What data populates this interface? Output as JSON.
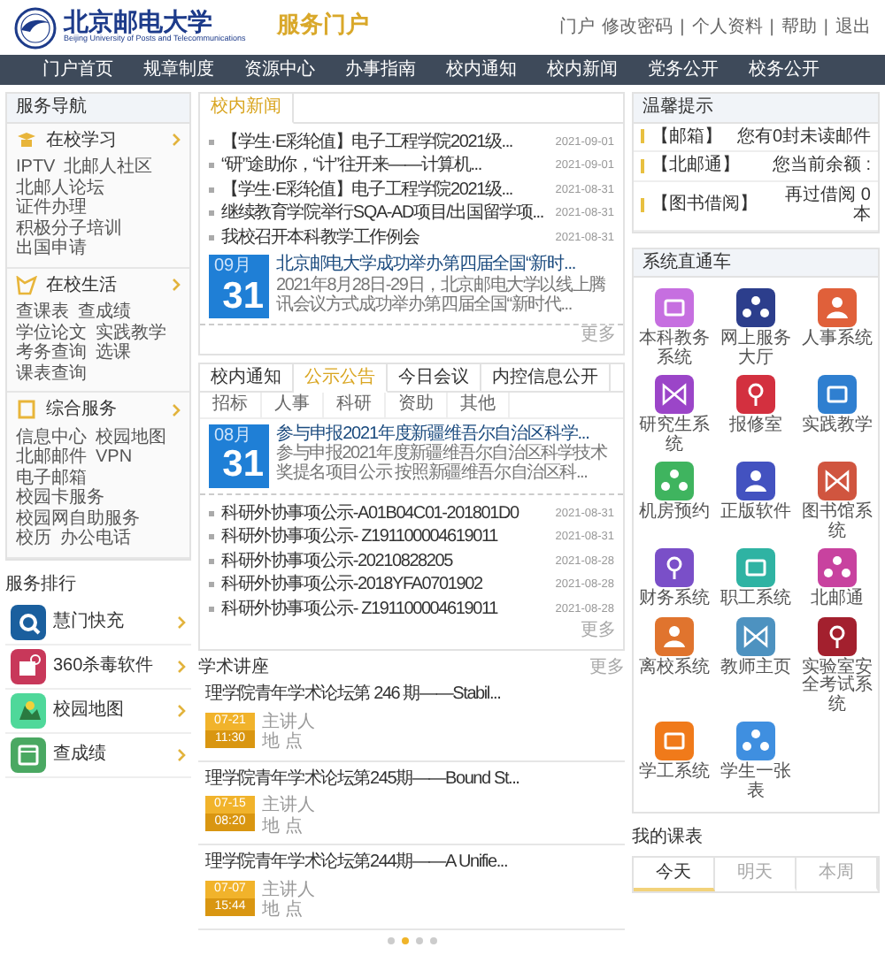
{
  "header": {
    "school_name": "北京邮电大学",
    "school_name_en": "Beijing University of Posts and Telecommunications",
    "portal_title": "服务门户",
    "user": "门户",
    "links": [
      "修改密码",
      "个人资料",
      "帮助",
      "退出"
    ],
    "separator": "|"
  },
  "nav": [
    "门户首页",
    "规章制度",
    "资源中心",
    "办事指南",
    "校内通知",
    "校内新闻",
    "党务公开",
    "校务公开"
  ],
  "service_nav": {
    "title": "服务导航",
    "sections": [
      {
        "title": "在校学习",
        "links": [
          "IPTV",
          "北邮人社区",
          "北邮人论坛",
          "证件办理",
          "积极分子培训",
          "出国申请"
        ]
      },
      {
        "title": "在校生活",
        "links": [
          "查课表",
          "查成绩",
          "学位论文",
          "实践教学",
          "考务查询",
          "选课",
          "课表查询"
        ]
      },
      {
        "title": "综合服务",
        "links": [
          "信息中心",
          "校园地图",
          "北邮邮件",
          "VPN",
          "电子邮箱",
          "校园卡服务",
          "校园网自助服务",
          "校历",
          "办公电话"
        ]
      }
    ]
  },
  "service_ranking": {
    "title": "服务排行",
    "items": [
      {
        "label": "慧门快充",
        "color": "#1a5f9e"
      },
      {
        "label": "360杀毒软件",
        "color": "#c8385a"
      },
      {
        "label": "校园地图",
        "color": "#4fd89a"
      },
      {
        "label": "查成绩",
        "color": "#4aa862"
      }
    ]
  },
  "campus_news": {
    "tabs": [
      {
        "label": "校内新闻",
        "selected": true
      }
    ],
    "items": [
      {
        "title": "【学生·E彩轮值】电子工程学院2021级...",
        "date": "2021-09-01"
      },
      {
        "title": "“研”途助你，“计”往开来——计算机...",
        "date": "2021-09-01"
      },
      {
        "title": "【学生·E彩轮值】电子工程学院2021级...",
        "date": "2021-08-31"
      },
      {
        "title": "继续教育学院举行SQA-AD项目/出国留学项...",
        "date": "2021-08-31"
      },
      {
        "title": "我校召开本科教学工作例会",
        "date": "2021-08-31"
      }
    ],
    "featured": {
      "month": "09月",
      "day": "31",
      "title": "北京邮电大学成功举办第四届全国“新时...",
      "summary": "2021年8月28日-29日，北京邮电大学以线上腾讯会议方式成功举办第四届全国“新时代..."
    },
    "more": "更多"
  },
  "notices": {
    "tabs": [
      {
        "label": "校内通知",
        "selected": false
      },
      {
        "label": "公示公告",
        "selected": true
      },
      {
        "label": "今日会议",
        "selected": false
      },
      {
        "label": "内控信息公开",
        "selected": false
      }
    ],
    "categories": [
      "招标",
      "人事",
      "科研",
      "资助",
      "其他"
    ],
    "featured": {
      "month": "08月",
      "day": "31",
      "title": "参与申报2021年度新疆维吾尔自治区科学...",
      "summary": "参与申报2021年度新疆维吾尔自治区科学技术奖提名项目公示 按照新疆维吾尔自治区科..."
    },
    "items": [
      {
        "title": "科研外协事项公示-A01B04C01-201801D0",
        "date": "2021-08-31"
      },
      {
        "title": "科研外协事项公示- Z191100004619011",
        "date": "2021-08-31"
      },
      {
        "title": "科研外协事项公示-20210828205",
        "date": "2021-08-28"
      },
      {
        "title": "科研外协事项公示-2018YFA0701902",
        "date": "2021-08-28"
      },
      {
        "title": "科研外协事项公示- Z191100004619011",
        "date": "2021-08-28"
      }
    ],
    "more": "更多"
  },
  "lectures": {
    "title": "学术讲座",
    "more": "更多",
    "items": [
      {
        "title": "理学院青年学术论坛第 246 期——Stabil...",
        "date": "07-21",
        "time": "11:30",
        "speaker_label": "主讲人",
        "place_label": "地 点"
      },
      {
        "title": "理学院青年学术论坛第245期——Bound St...",
        "date": "07-15",
        "time": "08:20",
        "speaker_label": "主讲人",
        "place_label": "地 点"
      },
      {
        "title": "理学院青年学术论坛第244期——A Unifie...",
        "date": "07-07",
        "time": "15:44",
        "speaker_label": "主讲人",
        "place_label": "地 点"
      }
    ],
    "pager": [
      {
        "selected": false
      },
      {
        "selected": true
      },
      {
        "selected": false
      },
      {
        "selected": false
      }
    ]
  },
  "tips": {
    "title": "温馨提示",
    "items": [
      {
        "label": "【邮箱】",
        "value": "您有0封未读邮件"
      },
      {
        "label": "【北邮通】",
        "value": "您当前余额 :"
      },
      {
        "label": "【图书借阅】",
        "value": "再过借阅 0 本"
      }
    ]
  },
  "systems": {
    "title": "系统直通车",
    "items": [
      {
        "label": "本科教务系统",
        "color": "#c66fe0"
      },
      {
        "label": "网上服务大厅",
        "color": "#2c3e8c"
      },
      {
        "label": "人事系统",
        "color": "#e0603a"
      },
      {
        "label": "研究生系统",
        "color": "#9b45c8"
      },
      {
        "label": "报修室",
        "color": "#d3303f"
      },
      {
        "label": "实践教学",
        "color": "#2f7fd0"
      },
      {
        "label": "机房预约",
        "color": "#3fb45f"
      },
      {
        "label": "正版软件",
        "color": "#4352c0"
      },
      {
        "label": "图书馆系统",
        "color": "#d0553f"
      },
      {
        "label": "财务系统",
        "color": "#7a4fc8"
      },
      {
        "label": "职工系统",
        "color": "#2fb3a3"
      },
      {
        "label": "北邮通",
        "color": "#c8429f"
      },
      {
        "label": "离校系统",
        "color": "#e0742e"
      },
      {
        "label": "教师主页",
        "color": "#4d92c0"
      },
      {
        "label": "实验室安全考试系统",
        "color": "#a3202e"
      },
      {
        "label": "学工系统",
        "color": "#f07a1a"
      },
      {
        "label": "学生一张表",
        "color": "#3f8fe0"
      }
    ]
  },
  "schedule": {
    "title": "我的课表",
    "tabs": [
      {
        "label": "今天",
        "selected": true
      },
      {
        "label": "明天",
        "selected": false
      },
      {
        "label": "本周",
        "selected": false
      }
    ]
  }
}
